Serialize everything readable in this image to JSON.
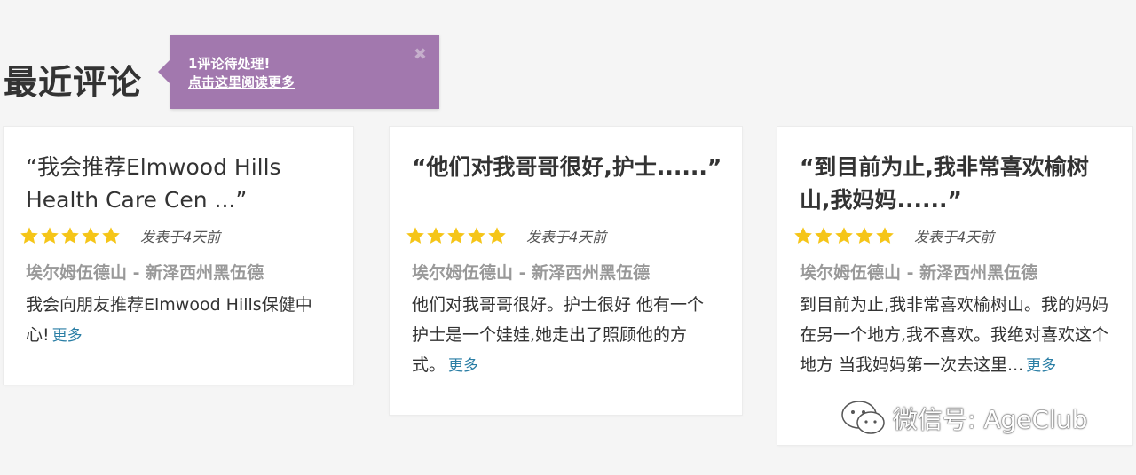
{
  "page": {
    "title": "最近评论"
  },
  "notice": {
    "line1": "1评论待处理!",
    "link": "点击这里阅读更多",
    "close": "✖",
    "background": "#a278ae"
  },
  "reviews": [
    {
      "title": "“我会推荐Elmwood Hills Health Care Cen ...”",
      "rating": 5,
      "posted": "发表于4天前",
      "location": "埃尔姆伍德山 - 新泽西州黑伍德",
      "body": "我会向朋友推荐Elmwood Hills保健中心!",
      "more": "更多"
    },
    {
      "title": "“他们对我哥哥很好,护士......”",
      "rating": 5,
      "posted": "发表于4天前",
      "location": "埃尔姆伍德山 - 新泽西州黑伍德",
      "body": "他们对我哥哥很好。护士很好 他有一个护士是一个娃娃,她走出了照顾他的方式。",
      "more": "更多"
    },
    {
      "title": "“到目前为止,我非常喜欢榆树山,我妈妈......”",
      "rating": 5,
      "posted": "发表于4天前",
      "location": "埃尔姆伍德山 - 新泽西州黑伍德",
      "body": "到目前为止,我非常喜欢榆树山。我的妈妈在另一个地方,我不喜欢。我绝对喜欢这个地方 当我妈妈第一次去这里...",
      "more": "更多"
    }
  ],
  "colors": {
    "star": "#f5c518",
    "link": "#2a7ea5",
    "location": "#999999"
  },
  "icons": {
    "star": "star-icon",
    "close": "close-icon",
    "watermark": "wechat-icon"
  },
  "watermark": {
    "text": "微信号: AgeClub"
  }
}
